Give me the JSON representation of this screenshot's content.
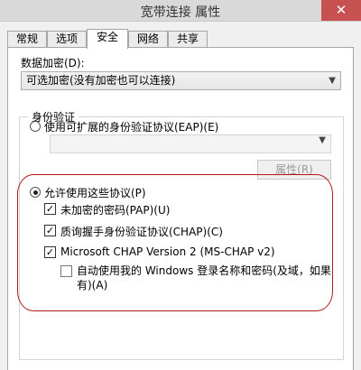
{
  "window": {
    "title": "宽带连接 属性",
    "close_glyph": "✕"
  },
  "tabs": [
    {
      "label": "常规"
    },
    {
      "label": "选项"
    },
    {
      "label": "安全",
      "active": true
    },
    {
      "label": "网络"
    },
    {
      "label": "共享"
    }
  ],
  "security": {
    "encryption_label": "数据加密(D):",
    "encryption_value": "可选加密(没有加密也可以连接)",
    "auth_group_title": "身份验证",
    "eap_option": "使用可扩展的身份验证协议(EAP)(E)",
    "eap_select_value": "",
    "properties_button": "属性(R)",
    "allow_protocols_option": "允许使用这些协议(P)",
    "protocols": [
      {
        "label": "未加密的密码(PAP)(U)",
        "checked": true
      },
      {
        "label": "质询握手身份验证协议(CHAP)(C)",
        "checked": true
      },
      {
        "label": "Microsoft CHAP Version 2 (MS-CHAP v2)",
        "checked": true
      }
    ],
    "auto_windows_login": {
      "label": "自动使用我的 Windows 登录名称和密码(及域，如果有)(A)",
      "checked": false
    },
    "check_glyph": "✓",
    "highlight_color": "#b11b1b"
  }
}
